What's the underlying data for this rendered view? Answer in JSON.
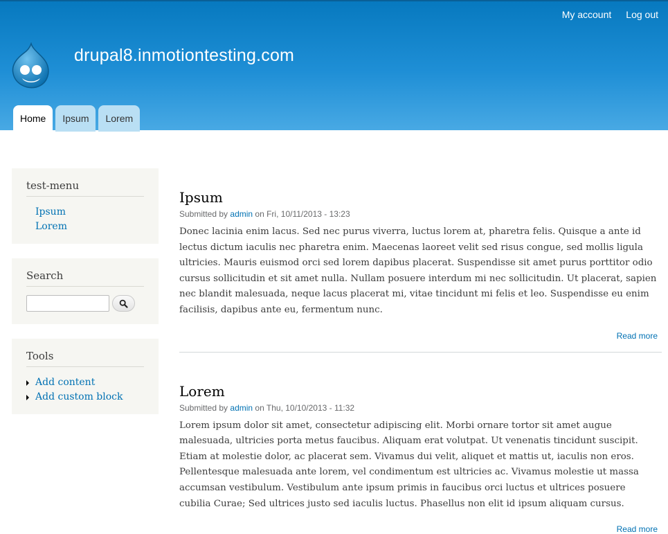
{
  "header": {
    "site_name": "drupal8.inmotiontesting.com",
    "secondary_menu": [
      "My account",
      "Log out"
    ],
    "tabs": [
      "Home",
      "Ipsum",
      "Lorem"
    ],
    "active_tab": "Home"
  },
  "sidebar": {
    "test_menu": {
      "title": "test-menu",
      "items": [
        "Ipsum",
        "Lorem"
      ]
    },
    "search": {
      "title": "Search",
      "input_value": ""
    },
    "tools": {
      "title": "Tools",
      "items": [
        "Add content",
        "Add custom block"
      ]
    }
  },
  "articles": [
    {
      "title": "Ipsum",
      "submitted_prefix": "Submitted by",
      "author": "admin",
      "date_text": "on Fri, 10/11/2013 - 13:23",
      "body": "Donec lacinia enim lacus. Sed nec purus viverra, luctus lorem at, pharetra felis. Quisque a ante id lectus dictum iaculis nec pharetra enim. Maecenas laoreet velit sed risus congue, sed mollis ligula ultricies. Mauris euismod orci sed lorem dapibus placerat. Suspendisse sit amet purus porttitor odio cursus sollicitudin et sit amet nulla. Nullam posuere interdum mi nec sollicitudin. Ut placerat, sapien nec blandit malesuada, neque lacus placerat mi, vitae tincidunt mi felis et leo. Suspendisse eu enim facilisis, dapibus ante eu, fermentum nunc.",
      "read_more": "Read more"
    },
    {
      "title": "Lorem",
      "submitted_prefix": "Submitted by",
      "author": "admin",
      "date_text": "on Thu, 10/10/2013 - 11:32",
      "body": "Lorem ipsum dolor sit amet, consectetur adipiscing elit. Morbi ornare tortor sit amet augue malesuada, ultricies porta metus faucibus. Aliquam erat volutpat. Ut venenatis tincidunt suscipit. Etiam at molestie dolor, ac placerat sem. Vivamus dui velit, aliquet et mattis ut, iaculis non eros. Pellentesque malesuada ante lorem, vel condimentum est ultricies ac. Vivamus molestie ut massa accumsan vestibulum. Vestibulum ante ipsum primis in faucibus orci luctus et ultrices posuere cubilia Curae; Sed ultrices justo sed iaculis luctus. Phasellus non elit id ipsum aliquam cursus.",
      "read_more": "Read more"
    }
  ],
  "icons": {
    "logo": "drupal-drop-logo",
    "search": "search-icon",
    "bullet": "triangle-bullet-icon"
  },
  "colors": {
    "header_top": "#0779bf",
    "header_bottom": "#48a9e4",
    "link": "#0071b3",
    "sidebar_bg": "#f6f6f2",
    "tab_bg": "#b9dff4"
  }
}
